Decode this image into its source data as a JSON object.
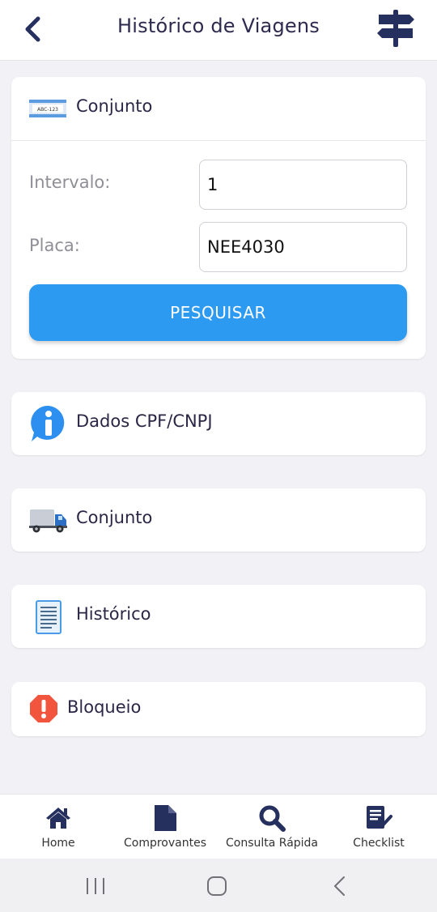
{
  "header": {
    "title": "Histórico de Viagens",
    "back_icon": "chevron-left-icon",
    "right_icon": "signpost-icon"
  },
  "search_card": {
    "title": "Conjunto",
    "icon": "license-plate-icon",
    "plate_text": "ABC-123",
    "interval_label": "Intervalo:",
    "interval_value": "1",
    "plate_label": "Placa:",
    "plate_value": "NEE4030",
    "search_button": "PESQUISAR"
  },
  "sections": [
    {
      "title": "Dados CPF/CNPJ",
      "icon": "info-bubble-icon"
    },
    {
      "title": "Conjunto",
      "icon": "truck-icon"
    },
    {
      "title": "Histórico",
      "icon": "document-list-icon"
    },
    {
      "title": "Bloqueio",
      "icon": "warning-octagon-icon"
    }
  ],
  "bottom_nav": [
    {
      "label": "Home",
      "icon": "home-icon"
    },
    {
      "label": "Comprovantes",
      "icon": "document-icon"
    },
    {
      "label": "Consulta Rápida",
      "icon": "search-icon"
    },
    {
      "label": "Checklist",
      "icon": "checklist-icon"
    }
  ],
  "system_nav": {
    "recents": "recents-icon",
    "home": "home-circle-icon",
    "back": "back-icon"
  },
  "colors": {
    "primary": "#2d9af2",
    "navy": "#26305e",
    "background": "#f2f2f6"
  }
}
